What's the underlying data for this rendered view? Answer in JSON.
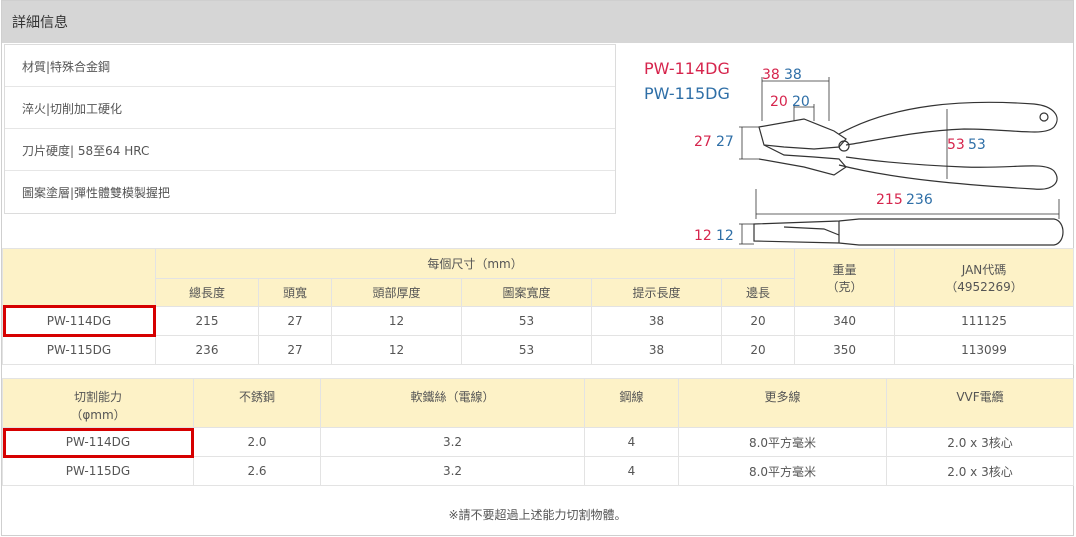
{
  "header": {
    "title": "詳細信息"
  },
  "specs": [
    "材質|特殊合金鋼",
    "淬火|切削加工硬化",
    "刀片硬度| 58至64 HRC",
    "圖案塗層|彈性體雙模製握把"
  ],
  "diagram": {
    "model1": "PW-114DG",
    "model2": "PW-115DG",
    "dim_a": {
      "v1": "38",
      "v2": "38"
    },
    "dim_b": {
      "v1": "20",
      "v2": "20"
    },
    "dim_c": {
      "v1": "27",
      "v2": "27"
    },
    "dim_d": {
      "v1": "53",
      "v2": "53"
    },
    "dim_e": {
      "v1": "215",
      "v2": "236"
    },
    "dim_f": {
      "v1": "12",
      "v2": "12"
    },
    "colors": {
      "model1": "#d6254d",
      "model2": "#2f6fa7"
    }
  },
  "size_table": {
    "group_header": "每個尺寸（mm）",
    "sub_headers": [
      "總長度",
      "頭寬",
      "頭部厚度",
      "圖案寬度",
      "提示長度",
      "邊長"
    ],
    "weight_header": "重量",
    "weight_unit": "（克）",
    "jan_header": "JAN代碼",
    "jan_sub": "（4952269）",
    "rows": [
      {
        "model": "PW-114DG",
        "values": [
          "215",
          "27",
          "12",
          "53",
          "38",
          "20"
        ],
        "weight": "340",
        "jan": "111125"
      },
      {
        "model": "PW-115DG",
        "values": [
          "236",
          "27",
          "12",
          "53",
          "38",
          "20"
        ],
        "weight": "350",
        "jan": "113099"
      }
    ]
  },
  "cut_table": {
    "header_label": "切割能力",
    "header_unit": "（φmm）",
    "headers": [
      "不銹鋼",
      "軟鐵絲（電線）",
      "鋼線",
      "更多線",
      "VVF電纜"
    ],
    "rows": [
      {
        "model": "PW-114DG",
        "values": [
          "2.0",
          "3.2",
          "4",
          "8.0平方毫米",
          "2.0 x 3核心"
        ]
      },
      {
        "model": "PW-115DG",
        "values": [
          "2.6",
          "3.2",
          "4",
          "8.0平方毫米",
          "2.0 x 3核心"
        ]
      }
    ]
  },
  "note": "※請不要超過上述能力切割物體。"
}
